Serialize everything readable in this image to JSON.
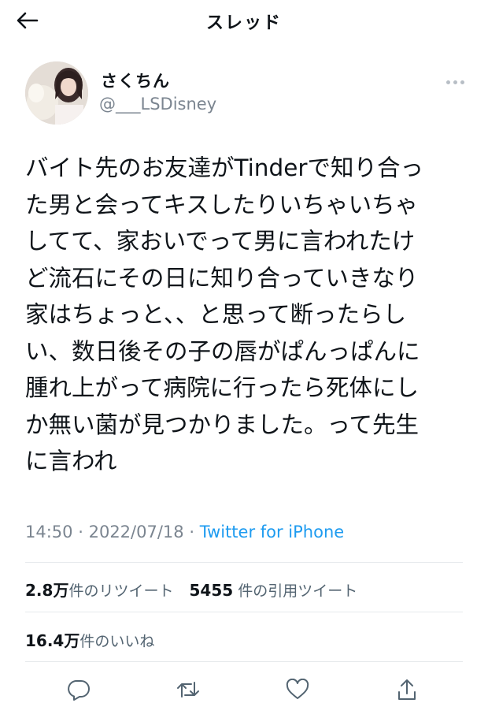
{
  "header": {
    "title": "スレッド",
    "back_icon": "back-arrow-icon"
  },
  "author": {
    "display_name": "さくちん",
    "handle": "@___LSDisney"
  },
  "tweet": {
    "lines": [
      "バイト先のお友達がTinderで知り合っ",
      "た男と会ってキスしたりいちゃいちゃ",
      "してて、家おいでって男に言われたけ",
      "ど流石にその日に知り合っていきなり",
      "家はちょっと、、と思って断ったらし",
      "い、数日後その子の唇がぱんっぱんに",
      "腫れ上がって病院に行ったら死体にし",
      "か無い菌が見つかりました。って先生",
      "に言われ"
    ],
    "time": "14:50",
    "separator": "·",
    "date": "2022/07/18",
    "source": "Twitter for iPhone"
  },
  "stats": {
    "retweets_num": "2.8",
    "retweets_unit": "万",
    "retweets_label": "件のリツイート",
    "quotes_num": "5455",
    "quotes_label": "件の引用ツイート",
    "likes_num": "16.4",
    "likes_unit": "万",
    "likes_label": "件のいいね"
  },
  "actions": [
    "reply-icon",
    "retweet-icon",
    "like-icon",
    "share-icon"
  ],
  "colors": {
    "link": "#1d9bf0",
    "muted": "#7b8590",
    "text": "#0f1419",
    "divider": "#e6e9ec"
  }
}
